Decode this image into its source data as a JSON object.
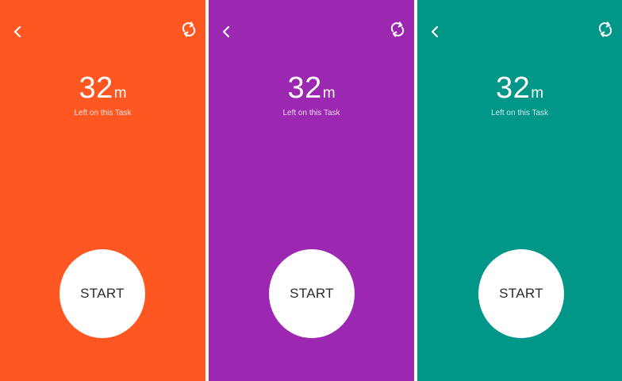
{
  "screens": [
    {
      "background": "#FF5722",
      "timer_value": "32",
      "timer_unit": "m",
      "caption": "Left on this Task",
      "start_label": "START",
      "back_icon": "chevron-left-icon",
      "refresh_icon": "refresh-icon"
    },
    {
      "background": "#9C27B0",
      "timer_value": "32",
      "timer_unit": "m",
      "caption": "Left on this Task",
      "start_label": "START",
      "back_icon": "chevron-left-icon",
      "refresh_icon": "refresh-icon"
    },
    {
      "background": "#009688",
      "timer_value": "32",
      "timer_unit": "m",
      "caption": "Left on this Task",
      "start_label": "START",
      "back_icon": "chevron-left-icon",
      "refresh_icon": "refresh-icon"
    }
  ],
  "colors": {
    "divider": "#FFFFFF",
    "icon": "#FFFFFF",
    "button_fill": "#FFFFFF",
    "button_text": "#2B2B2B"
  }
}
